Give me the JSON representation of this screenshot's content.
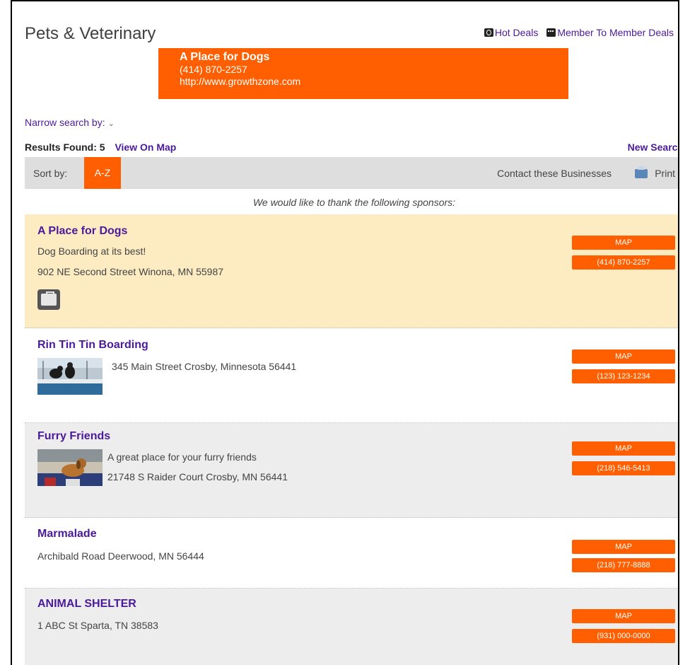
{
  "header": {
    "title": "Pets & Veterinary",
    "hot_deals": "Hot Deals",
    "member_deals": "Member To Member Deals"
  },
  "banner": {
    "name": "A Place for Dogs",
    "phone": "(414) 870-2257",
    "url": "http://www.growthzone.com"
  },
  "filters": {
    "narrow_label": "Narrow search by:"
  },
  "results": {
    "found_label": "Results Found: 5",
    "view_map": "View On Map",
    "new_search": "New Search"
  },
  "sort": {
    "label": "Sort by:",
    "option": "A-Z",
    "contact": "Contact these Businesses",
    "print": "Print"
  },
  "sponsors_text": "We would like to thank the following sponsors:",
  "listings": [
    {
      "name": "A Place for Dogs",
      "tagline": "Dog Boarding at its best!",
      "address": "902 NE Second Street Winona, MN 55987",
      "map": "MAP",
      "phone": "(414) 870-2257"
    },
    {
      "name": "Rin Tin Tin Boarding",
      "address": "345 Main Street Crosby, Minnesota 56441",
      "map": "MAP",
      "phone": "(123) 123-1234"
    },
    {
      "name": "Furry Friends",
      "tagline": "A great place for your furry friends",
      "address": "21748 S Raider Court Crosby, MN 56441",
      "map": "MAP",
      "phone": "(218) 546-5413"
    },
    {
      "name": "Marmalade",
      "address": "Archibald Road Deerwood, MN 56444",
      "map": "MAP",
      "phone": "(218) 777-8888"
    },
    {
      "name": "ANIMAL SHELTER",
      "address": "1 ABC St Sparta, TN 38583",
      "map": "MAP",
      "phone": "(931) 000-0000"
    }
  ],
  "colors": {
    "accent": "#ff5f00",
    "link": "#4b1a9b",
    "sponsor_bg": "#fdebc2",
    "alt_row_bg": "#ededed",
    "sort_bar_bg": "#dedede"
  }
}
